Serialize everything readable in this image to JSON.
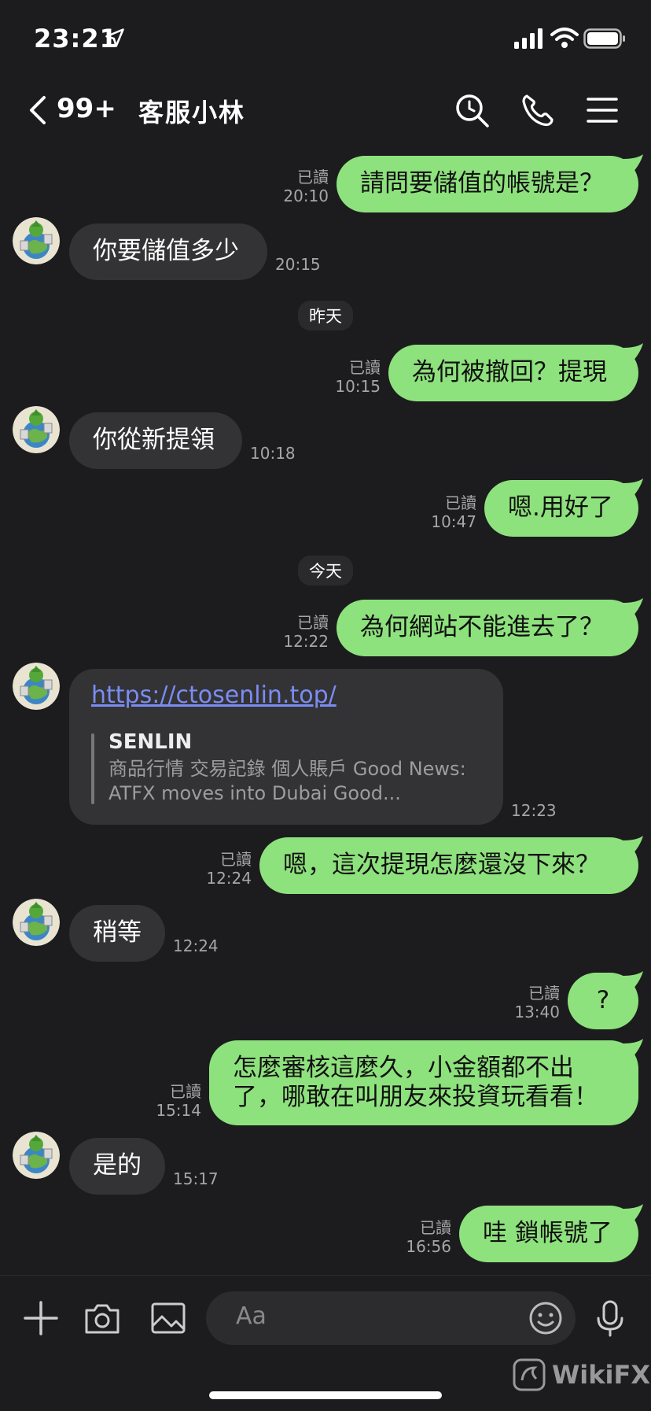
{
  "status": {
    "time": "23:21"
  },
  "header": {
    "unread": "99+",
    "title": "客服小林"
  },
  "messages": [
    {
      "text": "請問要儲值的帳號是？",
      "read": "已讀",
      "time": "20:10"
    },
    {
      "text": "你要儲值多少",
      "time": "20:15"
    },
    {
      "text": "為何被撤回？提現",
      "read": "已讀",
      "time": "10:15"
    },
    {
      "text": "你從新提領",
      "time": "10:18"
    },
    {
      "text": "嗯.用好了",
      "read": "已讀",
      "time": "10:47"
    },
    {
      "text": "為何網站不能進去了？",
      "read": "已讀",
      "time": "12:22"
    },
    {
      "text": "嗯，這次提現怎麼還沒下來？",
      "read": "已讀",
      "time": "12:24"
    },
    {
      "text": "稍等",
      "time": "12:24"
    },
    {
      "text": "?",
      "read": "已讀",
      "time": "13:40"
    },
    {
      "line1": "怎麼審核這麼久，小金額都不出",
      "line2": "了，哪敢在叫朋友來投資玩看看！",
      "read": "已讀",
      "time": "15:14"
    },
    {
      "text": "是的",
      "time": "15:17"
    },
    {
      "text": "哇 鎖帳號了",
      "read": "已讀",
      "time": "16:56"
    }
  ],
  "dates": {
    "yesterday": "昨天",
    "today": "今天"
  },
  "link": {
    "url": "https://ctosenlin.top/",
    "title": "SENLIN",
    "desc": "商品行情 交易記錄 個人賬戶 Good News: ATFX moves into Dubai Good...",
    "time": "12:23"
  },
  "input": {
    "placeholder": "Aa"
  },
  "watermark": {
    "text": "WikiFX"
  },
  "colors": {
    "outgoing": "#8ee27d",
    "incoming": "#333335",
    "background": "#1c1c1e",
    "link": "#7b8cf3"
  }
}
